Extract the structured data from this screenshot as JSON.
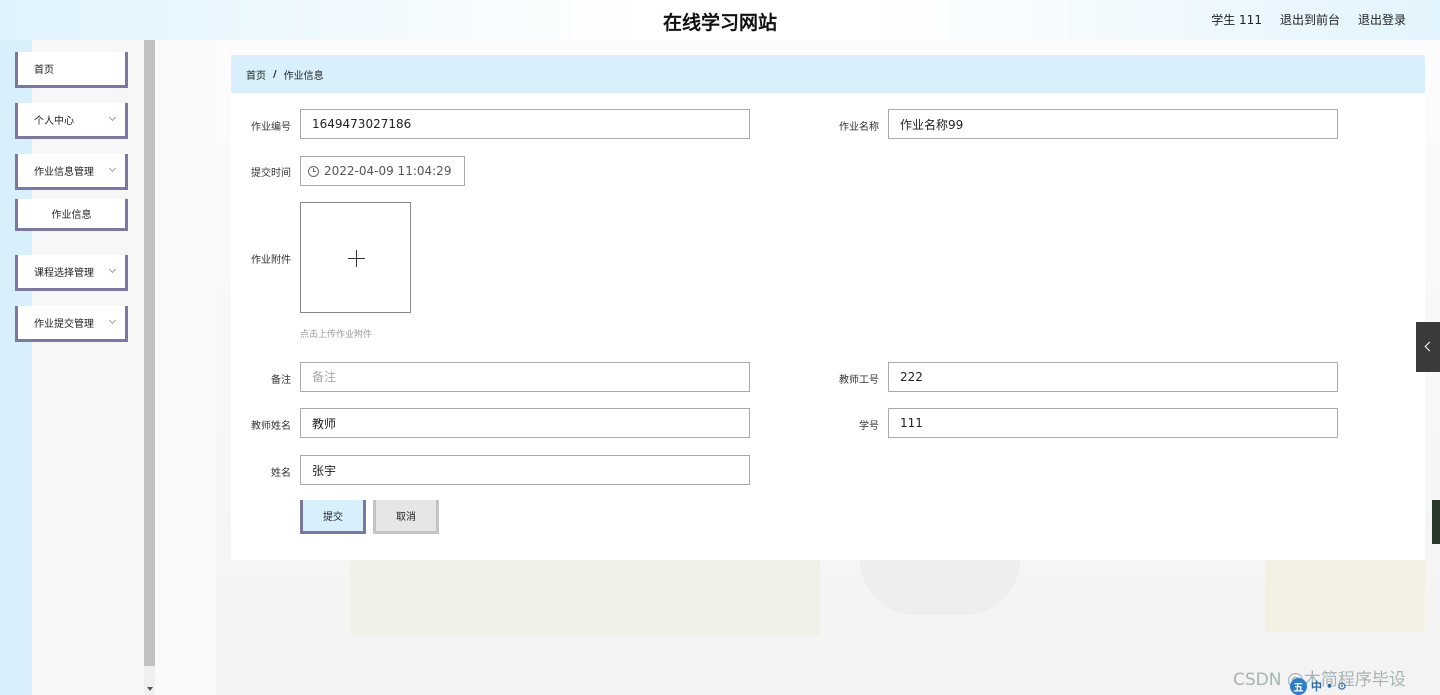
{
  "header": {
    "title": "在线学习网站",
    "user": "学生 111",
    "to_frontend": "退出到前台",
    "logout": "退出登录"
  },
  "sidebar": {
    "items": [
      {
        "label": "首页"
      },
      {
        "label": "个人中心"
      },
      {
        "label": "作业信息管理"
      },
      {
        "label": "作业信息"
      },
      {
        "label": "课程选择管理"
      },
      {
        "label": "作业提交管理"
      }
    ]
  },
  "breadcrumb": {
    "home": "首页",
    "separator": "/",
    "current": "作业信息"
  },
  "form": {
    "homework_no": {
      "label": "作业编号",
      "value": "1649473027186"
    },
    "homework_name": {
      "label": "作业名称",
      "value": "作业名称99"
    },
    "submit_time": {
      "label": "提交时间",
      "value": "2022-04-09 11:04:29"
    },
    "attachment": {
      "label": "作业附件",
      "hint": "点击上传作业附件"
    },
    "remark": {
      "label": "备注",
      "placeholder": "备注",
      "value": ""
    },
    "teacher_no": {
      "label": "教师工号",
      "value": "222"
    },
    "teacher_name": {
      "label": "教师姓名",
      "value": "教师"
    },
    "student_no": {
      "label": "学号",
      "value": "111"
    },
    "name": {
      "label": "姓名",
      "value": "张宇"
    },
    "submit_label": "提交",
    "cancel_label": "取消"
  },
  "watermark": "CSDN @木简程序毕设",
  "ime": {
    "logo": "五",
    "mode": "中"
  },
  "colors": {
    "accent_border": "#7a77a0",
    "breadcrumb_bg": "#d8f0fb",
    "header_bg": "#dff3fd"
  }
}
